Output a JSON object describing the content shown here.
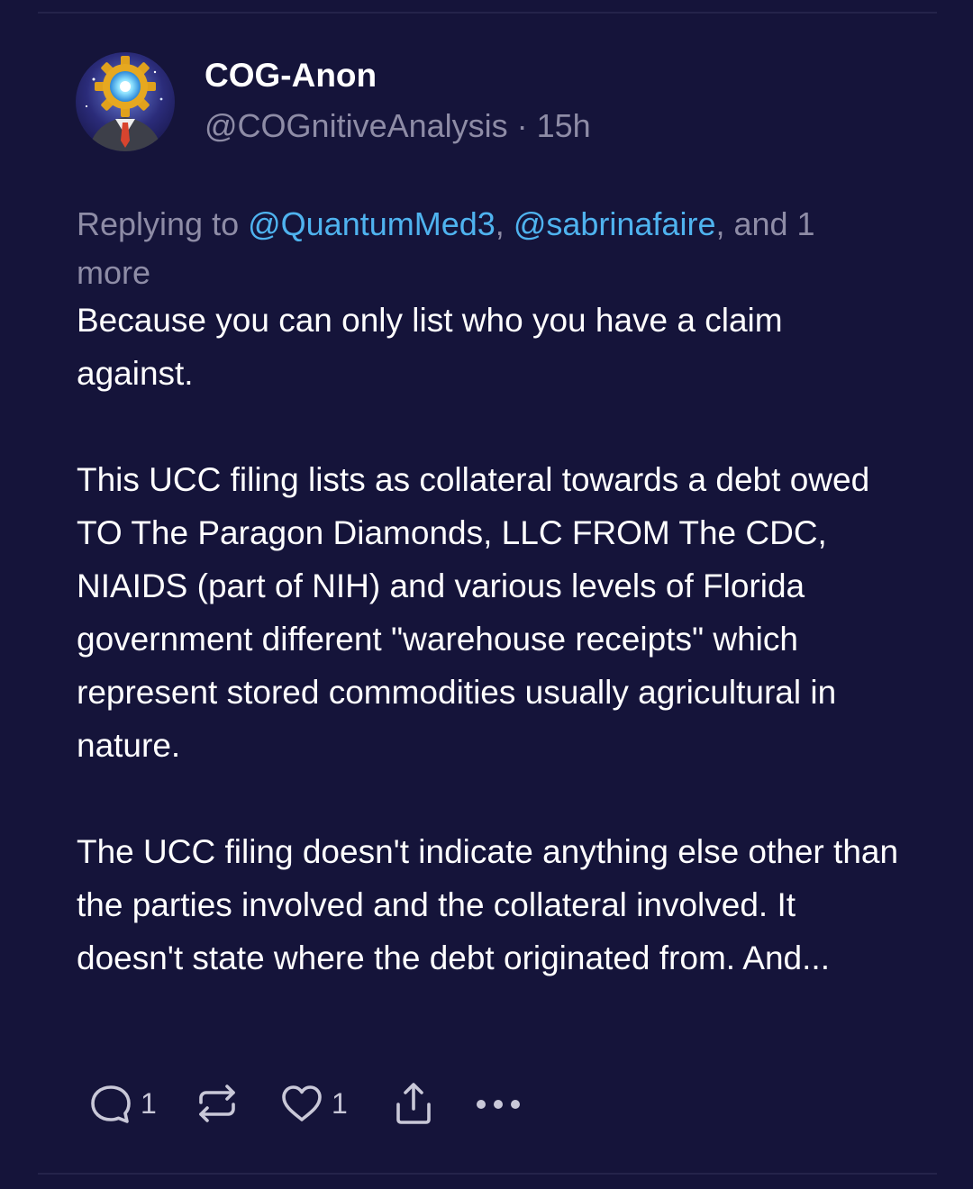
{
  "post": {
    "author": {
      "display_name": "COG-Anon",
      "handle": "@COGnitiveAnalysis",
      "separator": " · ",
      "time": "15h"
    },
    "reply": {
      "prefix": "Replying to ",
      "mentions": [
        "@QuantumMed3",
        "@sabrinafaire"
      ],
      "comma": ", ",
      "suffix": ", and 1 more"
    },
    "paragraphs": [
      "Because you can only list who you have a claim against.",
      "This UCC filing lists as collateral towards a debt owed TO The Paragon Diamonds, LLC FROM The CDC, NIAIDS (part of NIH) and various levels of Florida government different \"warehouse receipts\" which represent stored commodities usually agricultural in nature.",
      "The UCC filing doesn't indicate anything else other than the parties involved and the collateral involved. It doesn't state where the debt originated from. And..."
    ],
    "actions": {
      "reply_icon": "comment-bubble-icon",
      "reply_count": "1",
      "repost_icon": "repost-arrows-icon",
      "like_icon": "heart-icon",
      "like_count": "1",
      "share_icon": "share-upload-icon",
      "more_icon": "more-dots-icon"
    }
  },
  "colors": {
    "background": "#15143a",
    "muted_text": "#8e8ca6",
    "mention": "#4fb3ef",
    "primary_text": "#ffffff",
    "icon": "#c9c8d8"
  }
}
